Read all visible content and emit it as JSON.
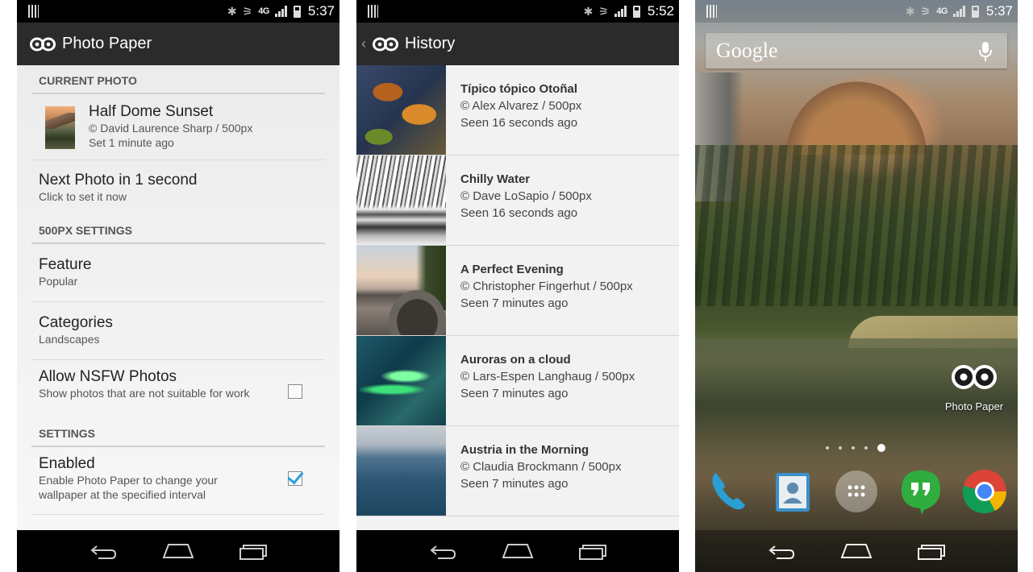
{
  "status": {
    "net_label": "4G",
    "time_settings": "5:37",
    "time_history": "5:52",
    "time_home": "5:37"
  },
  "settings_screen": {
    "title": "Photo Paper",
    "current_photo_header": "CURRENT PHOTO",
    "current_photo": {
      "title": "Half Dome Sunset",
      "credit": "© David Laurence Sharp / 500px",
      "set_time": "Set 1 minute ago"
    },
    "next_photo": {
      "title": "Next Photo in 1 second",
      "subtitle": "Click to set it now"
    },
    "px_settings_header": "500PX SETTINGS",
    "feature": {
      "title": "Feature",
      "value": "Popular"
    },
    "categories": {
      "title": "Categories",
      "value": "Landscapes"
    },
    "nsfw": {
      "title": "Allow NSFW Photos",
      "subtitle": "Show photos that are not suitable for work",
      "checked": false
    },
    "settings_header": "SETTINGS",
    "enabled": {
      "title": "Enabled",
      "subtitle": "Enable Photo Paper to change your wallpaper at the specified interval",
      "checked": true
    }
  },
  "history_screen": {
    "title": "History",
    "items": [
      {
        "title": "Típico tópico Otoñal",
        "credit": "© Alex Alvarez / 500px",
        "seen": "Seen 16 seconds ago"
      },
      {
        "title": "Chilly Water",
        "credit": "© Dave LoSapio / 500px",
        "seen": "Seen 16 seconds ago"
      },
      {
        "title": "A Perfect Evening",
        "credit": "© Christopher Fingerhut / 500px",
        "seen": "Seen 7 minutes ago"
      },
      {
        "title": "Auroras on a cloud",
        "credit": "© Lars-Espen Langhaug / 500px",
        "seen": "Seen 7 minutes ago"
      },
      {
        "title": "Austria in the Morning",
        "credit": "© Claudia Brockmann / 500px",
        "seen": "Seen 7 minutes ago"
      }
    ]
  },
  "home_screen": {
    "search_logo": "Google",
    "shortcut_label": "Photo Paper",
    "dock_apps": [
      "phone-app-icon",
      "contacts-app-icon",
      "app-drawer-icon",
      "hangouts-app-icon",
      "chrome-app-icon"
    ]
  },
  "colors": {
    "action_bar": "#2b2b2b",
    "checkbox_accent": "#2a9fd6",
    "status_bar": "#000000"
  }
}
